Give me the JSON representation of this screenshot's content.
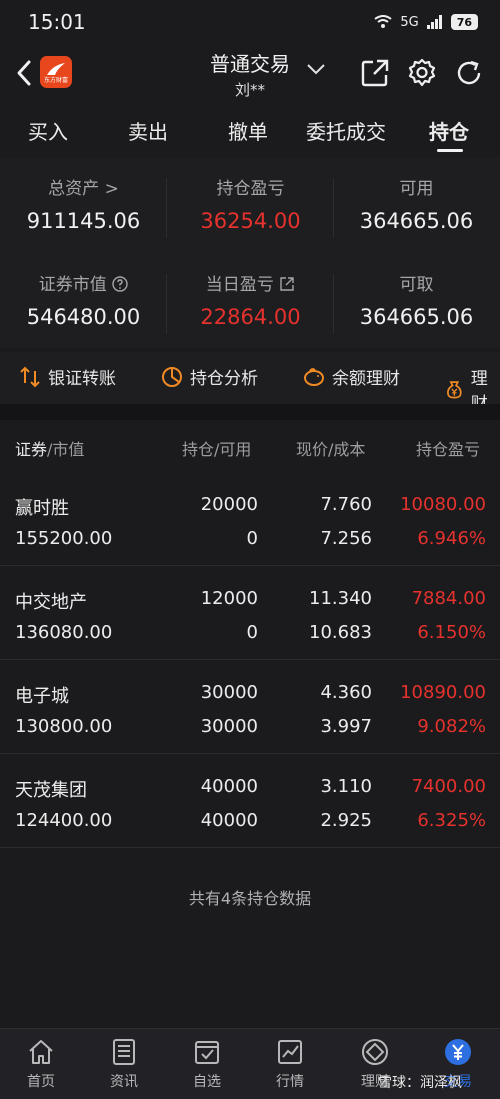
{
  "status": {
    "time": "15:01",
    "signal": "5G",
    "battery": "76"
  },
  "header": {
    "title": "普通交易",
    "subtitle": "刘**",
    "logo_text": "东方财富",
    "colors": {
      "logo": "#e8471d"
    }
  },
  "tabs": [
    {
      "label": "买入"
    },
    {
      "label": "卖出"
    },
    {
      "label": "撤单"
    },
    {
      "label": "委托成交"
    },
    {
      "label": "持仓",
      "active": true
    }
  ],
  "summary": {
    "total_assets": {
      "label": "总资产 >",
      "value": "911145.06"
    },
    "holding_pnl": {
      "label": "持仓盈亏",
      "value": "36254.00"
    },
    "available": {
      "label": "可用",
      "value": "364665.06"
    },
    "market_value": {
      "label": "证券市值",
      "value": "546480.00"
    },
    "daily_pnl": {
      "label": "当日盈亏",
      "value": "22864.00"
    },
    "withdrawable": {
      "label": "可取",
      "value": "364665.06"
    }
  },
  "quick_links": [
    {
      "label": "银证转账",
      "icon": "transfer-icon"
    },
    {
      "label": "持仓分析",
      "icon": "pie-chart-icon"
    },
    {
      "label": "余额理财",
      "icon": "piggy-bank-icon"
    },
    {
      "label": "理财",
      "icon": "money-bag-icon"
    }
  ],
  "table": {
    "headers": {
      "security": "证券",
      "market_value": "/市值",
      "position": "持仓/可用",
      "price": "现价/成本",
      "pnl": "持仓盈亏"
    },
    "rows": [
      {
        "name": "赢时胜",
        "market_value": "155200.00",
        "position": "20000",
        "available": "0",
        "price": "7.760",
        "cost": "7.256",
        "pnl": "10080.00",
        "pnl_pct": "6.946%"
      },
      {
        "name": "中交地产",
        "market_value": "136080.00",
        "position": "12000",
        "available": "0",
        "price": "11.340",
        "cost": "10.683",
        "pnl": "7884.00",
        "pnl_pct": "6.150%"
      },
      {
        "name": "电子城",
        "market_value": "130800.00",
        "position": "30000",
        "available": "30000",
        "price": "4.360",
        "cost": "3.997",
        "pnl": "10890.00",
        "pnl_pct": "9.082%"
      },
      {
        "name": "天茂集团",
        "market_value": "124400.00",
        "position": "40000",
        "available": "40000",
        "price": "3.110",
        "cost": "2.925",
        "pnl": "7400.00",
        "pnl_pct": "6.325%"
      }
    ]
  },
  "footer_note": "共有4条持仓数据",
  "bottom_nav": [
    {
      "label": "首页",
      "icon": "home-icon"
    },
    {
      "label": "资讯",
      "icon": "news-icon"
    },
    {
      "label": "自选",
      "icon": "watchlist-icon"
    },
    {
      "label": "行情",
      "icon": "market-chart-icon"
    },
    {
      "label": "理财",
      "icon": "finance-icon"
    },
    {
      "label": "交易",
      "icon": "trade-yen-icon",
      "active": true
    }
  ],
  "watermark": "雪球：润泽枫",
  "colors": {
    "profit_red": "#e5322d",
    "accent_blue": "#2d6fe0",
    "quick_icon_orange": "#f08a24"
  }
}
